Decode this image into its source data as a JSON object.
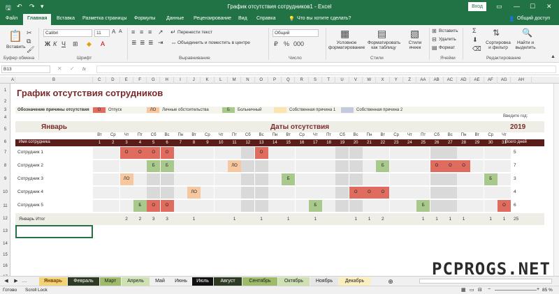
{
  "window": {
    "title": "График отсутствия сотрудников1  -  Excel",
    "login": "Вход"
  },
  "tabs": [
    "Файл",
    "Главная",
    "Вставка",
    "Разметка страницы",
    "Формулы",
    "Данные",
    "Рецензирование",
    "Вид",
    "Справка"
  ],
  "tell_me": "Что вы хотите сделать?",
  "share": "Общий доступ",
  "ribbon": {
    "font_name": "Calibri",
    "font_size": "11",
    "wrap_text": "Перенести текст",
    "merge": "Объединить и поместить в центре",
    "number_format": "Общий",
    "cond_format": "Условное форматирование",
    "format_table": "Форматировать как таблицу",
    "cell_styles": "Стили ячеек",
    "insert": "Вставить",
    "delete": "Удалить",
    "format": "Формат",
    "sort": "Сортировка и фильтр",
    "find": "Найти и выделить",
    "paste": "Вставить",
    "groups": [
      "Буфер обмена",
      "Шрифт",
      "Выравнивание",
      "Число",
      "Стили",
      "Ячейки",
      "Редактирование"
    ]
  },
  "formula_bar": {
    "name_box": "B13",
    "fx": "fx",
    "content": ""
  },
  "columns": [
    "A",
    "B",
    "C",
    "D",
    "E",
    "F",
    "G",
    "H",
    "I",
    "J",
    "K",
    "L",
    "M",
    "N",
    "O",
    "P",
    "Q",
    "R",
    "S",
    "T",
    "U",
    "V",
    "W",
    "X",
    "Y",
    "Z",
    "AA",
    "AB",
    "AC",
    "AD",
    "AE",
    "AF",
    "AG",
    "AH"
  ],
  "rows": [
    "1",
    "2",
    "3",
    "4",
    "5",
    "6",
    "7",
    "8",
    "9",
    "10",
    "11",
    "12",
    "13",
    "14",
    "15",
    "16",
    "17"
  ],
  "sheet": {
    "title": "График отсутствия сотрудников",
    "legend_label": "Обозначение причины отсутствия",
    "legend": [
      {
        "code": "О",
        "text": "Отпуск",
        "color": "#e06c60"
      },
      {
        "code": "ЛО",
        "text": "Личные обстоятельства",
        "color": "#f7c8a0"
      },
      {
        "code": "Б",
        "text": "Больничный",
        "color": "#a8c88c"
      },
      {
        "code": "",
        "text": "Собственная причина 1",
        "color": "#fce4b0"
      },
      {
        "code": "",
        "text": "Собственная причина 2",
        "color": "#c4c9e0"
      }
    ],
    "year_label": "Введите год:",
    "year": "2019",
    "month": "Январь",
    "dates_header": "Даты отсутствия",
    "emp_header": "Имя сотрудника",
    "total_header": "Всего дней",
    "total_row_label": "Январь Итог",
    "days": [
      "Вт",
      "Ср",
      "Чт",
      "Пт",
      "Сб",
      "Вс",
      "Пн",
      "Вт",
      "Ср",
      "Чт",
      "Пт",
      "Сб",
      "Вс",
      "Пн",
      "Вт",
      "Ср",
      "Чт",
      "Пт",
      "Сб",
      "Вс",
      "Пн",
      "Вт",
      "Ср",
      "Чт",
      "Пт",
      "Сб",
      "Вс",
      "Пн",
      "Вт",
      "Ср",
      "Чт"
    ],
    "nums": [
      "1",
      "2",
      "3",
      "4",
      "5",
      "6",
      "7",
      "8",
      "9",
      "10",
      "11",
      "12",
      "13",
      "14",
      "15",
      "16",
      "17",
      "18",
      "19",
      "20",
      "21",
      "22",
      "23",
      "24",
      "25",
      "26",
      "27",
      "28",
      "29",
      "30",
      "31"
    ],
    "employees": [
      {
        "name": "Сотрудник 1",
        "total": "5",
        "marks": {
          "3": "О",
          "4": "О",
          "5": "О",
          "6": "О",
          "13": "О"
        }
      },
      {
        "name": "Сотрудник 2",
        "total": "7",
        "marks": {
          "5": "Б",
          "6": "Б",
          "11": "ЛО",
          "22": "Б",
          "26": "О",
          "27": "О",
          "28": "О"
        }
      },
      {
        "name": "Сотрудник 3",
        "total": "3",
        "marks": {
          "3": "ЛО",
          "15": "Б",
          "30": "Б"
        }
      },
      {
        "name": "Сотрудник 4",
        "total": "4",
        "marks": {
          "8": "ЛО",
          "20": "О",
          "21": "О",
          "22": "О"
        }
      },
      {
        "name": "Сотрудник 5",
        "total": "6",
        "marks": {
          "4": "Б",
          "5": "О",
          "6": "О",
          "17": "Б",
          "25": "Б",
          "31": "О"
        }
      }
    ],
    "day_totals": {
      "3": "2",
      "4": "2",
      "5": "3",
      "6": "3",
      "8": "1",
      "11": "1",
      "13": "1",
      "15": "1",
      "17": "1",
      "20": "1",
      "21": "1",
      "22": "2",
      "25": "1",
      "26": "1",
      "27": "1",
      "28": "1",
      "30": "1",
      "31": "1"
    },
    "grand_total": "25"
  },
  "sheet_tabs": [
    {
      "label": "Январь",
      "bg": "#f1d37a",
      "fg": "#7a3b00",
      "active": true
    },
    {
      "label": "Февраль",
      "bg": "#2f3a24",
      "fg": "#ffffff"
    },
    {
      "label": "Март",
      "bg": "#9dbb6a",
      "fg": "#1a1a1a"
    },
    {
      "label": "Апрель",
      "bg": "#cfe1b2",
      "fg": "#1a1a1a"
    },
    {
      "label": "Май",
      "bg": "#f0f0f0",
      "fg": "#1a1a1a"
    },
    {
      "label": "Июнь",
      "bg": "#f0f0f0",
      "fg": "#1a1a1a"
    },
    {
      "label": "Июль",
      "bg": "#111111",
      "fg": "#ffffff"
    },
    {
      "label": "Август",
      "bg": "#2f3a24",
      "fg": "#ffffff"
    },
    {
      "label": "Сентябрь",
      "bg": "#9dbb6a",
      "fg": "#1a1a1a"
    },
    {
      "label": "Октябрь",
      "bg": "#cfe1b2",
      "fg": "#1a1a1a"
    },
    {
      "label": "Ноябрь",
      "bg": "#e6e6e6",
      "fg": "#1a1a1a"
    },
    {
      "label": "Декабрь",
      "bg": "#fbefc0",
      "fg": "#1a1a1a"
    }
  ],
  "status": {
    "ready": "Готово",
    "scroll_lock": "Scroll Lock",
    "zoom": "85 %"
  },
  "watermark": "PCPROGS.NET",
  "colors": {
    "accent": "#217346",
    "title": "#7b2a2a",
    "dark_row": "#5a1d1a",
    "weekend": "#d9d9d9"
  }
}
